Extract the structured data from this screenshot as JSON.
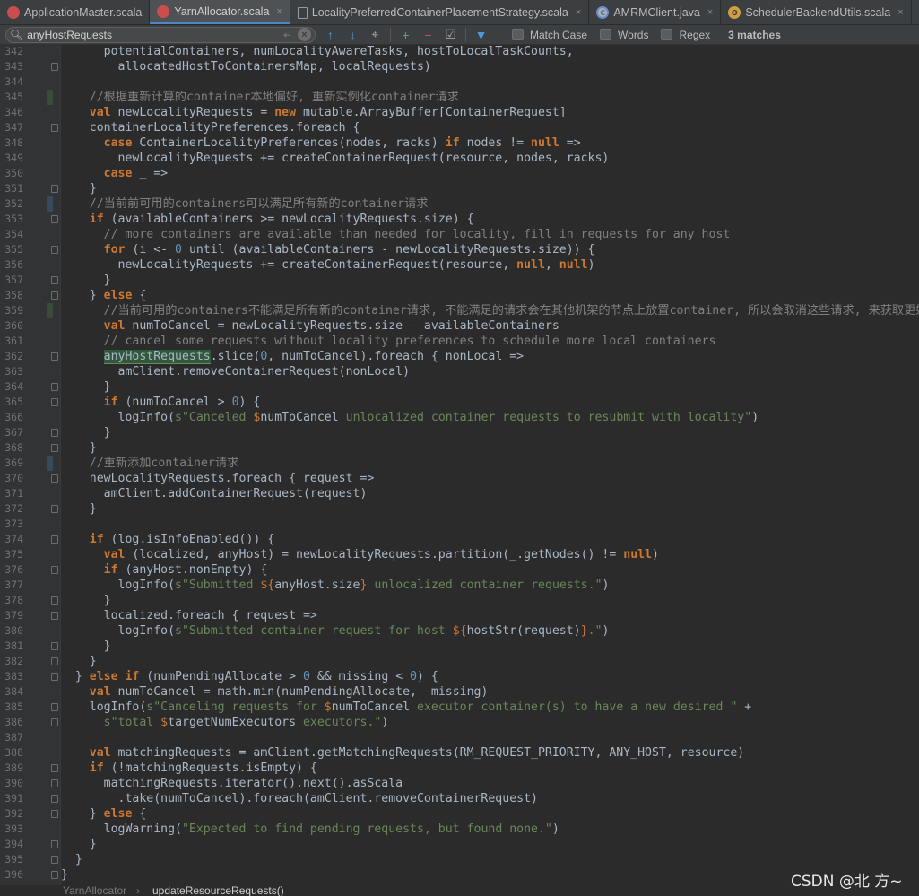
{
  "tabs": [
    {
      "label": "ApplicationMaster.scala",
      "icon": "scala-file-icon",
      "active": false,
      "closable": false
    },
    {
      "label": "YarnAllocator.scala",
      "icon": "scala-file-icon",
      "active": true,
      "closable": true
    },
    {
      "label": "LocalityPreferredContainerPlacementStrategy.scala",
      "icon": "file-icon",
      "active": false,
      "closable": true
    },
    {
      "label": "AMRMClient.java",
      "icon": "java-class-icon",
      "active": false,
      "closable": true
    },
    {
      "label": "SchedulerBackendUtils.scala",
      "icon": "scala-object-icon",
      "active": false,
      "closable": true
    },
    {
      "label": "U",
      "icon": "file-icon",
      "active": false,
      "closable": false
    }
  ],
  "findbar": {
    "query": "anyHostRequests",
    "match_case": "Match Case",
    "words": "Words",
    "regex": "Regex",
    "matches": "3 matches"
  },
  "lines": [
    {
      "n": 342,
      "marker": "",
      "fold": false,
      "indent": 0,
      "tokens": [
        [
          "      potentialContainers, numLocalityAwareTasks, hostToLocalTaskCounts,",
          ""
        ]
      ]
    },
    {
      "n": 343,
      "marker": "",
      "fold": true,
      "indent": 0,
      "tokens": [
        [
          "        allocatedHostToContainersMap, localRequests)",
          ""
        ]
      ]
    },
    {
      "n": 344,
      "marker": "",
      "fold": false,
      "indent": 0,
      "tokens": [
        [
          "",
          ""
        ]
      ]
    },
    {
      "n": 345,
      "marker": "green",
      "fold": false,
      "indent": 0,
      "tokens": [
        [
          "    //根据重新计算的container本地偏好, 重新实例化container请求",
          "cm"
        ]
      ]
    },
    {
      "n": 346,
      "marker": "",
      "fold": false,
      "indent": 0,
      "tokens": [
        [
          "    ",
          ""
        ],
        [
          "val",
          "kw"
        ],
        [
          " newLocalityRequests = ",
          ""
        ],
        [
          "new",
          "kw"
        ],
        [
          " mutable.ArrayBuffer[ContainerRequest]",
          ""
        ]
      ]
    },
    {
      "n": 347,
      "marker": "",
      "fold": true,
      "indent": 0,
      "tokens": [
        [
          "    containerLocalityPreferences.foreach {",
          ""
        ]
      ]
    },
    {
      "n": 348,
      "marker": "",
      "fold": false,
      "indent": 0,
      "tokens": [
        [
          "      ",
          ""
        ],
        [
          "case",
          "kw"
        ],
        [
          " ContainerLocalityPreferences(nodes, racks) ",
          ""
        ],
        [
          "if",
          "kw"
        ],
        [
          " nodes != ",
          ""
        ],
        [
          "null",
          "kw"
        ],
        [
          " =>",
          ""
        ]
      ]
    },
    {
      "n": 349,
      "marker": "",
      "fold": false,
      "indent": 0,
      "tokens": [
        [
          "        newLocalityRequests += createContainerRequest(resource, nodes, racks)",
          ""
        ]
      ]
    },
    {
      "n": 350,
      "marker": "",
      "fold": false,
      "indent": 0,
      "tokens": [
        [
          "      ",
          ""
        ],
        [
          "case",
          "kw"
        ],
        [
          " _ =>",
          ""
        ]
      ]
    },
    {
      "n": 351,
      "marker": "",
      "fold": true,
      "indent": 0,
      "tokens": [
        [
          "    }",
          ""
        ]
      ]
    },
    {
      "n": 352,
      "marker": "blue",
      "fold": false,
      "indent": 0,
      "tokens": [
        [
          "    //当前前可用的containers可以满足所有新的container请求",
          "cm"
        ]
      ]
    },
    {
      "n": 353,
      "marker": "",
      "fold": true,
      "indent": 0,
      "tokens": [
        [
          "    ",
          ""
        ],
        [
          "if",
          "kw"
        ],
        [
          " (availableContainers >= newLocalityRequests.size) {",
          ""
        ]
      ]
    },
    {
      "n": 354,
      "marker": "",
      "fold": false,
      "indent": 0,
      "tokens": [
        [
          "      // more containers are available than needed for locality, fill in requests for any host",
          "cm"
        ]
      ]
    },
    {
      "n": 355,
      "marker": "",
      "fold": true,
      "indent": 0,
      "tokens": [
        [
          "      ",
          ""
        ],
        [
          "for",
          "kw"
        ],
        [
          " (i <- ",
          ""
        ],
        [
          "0",
          "num"
        ],
        [
          " until (availableContainers - newLocalityRequests.size)) {",
          ""
        ]
      ]
    },
    {
      "n": 356,
      "marker": "",
      "fold": false,
      "indent": 0,
      "tokens": [
        [
          "        newLocalityRequests += createContainerRequest(resource, ",
          ""
        ],
        [
          "null",
          "kw"
        ],
        [
          ", ",
          ""
        ],
        [
          "null",
          "kw"
        ],
        [
          ")",
          ""
        ]
      ]
    },
    {
      "n": 357,
      "marker": "",
      "fold": true,
      "indent": 0,
      "tokens": [
        [
          "      }",
          ""
        ]
      ]
    },
    {
      "n": 358,
      "marker": "",
      "fold": true,
      "indent": 0,
      "tokens": [
        [
          "    } ",
          ""
        ],
        [
          "else",
          "kw"
        ],
        [
          " {",
          ""
        ]
      ]
    },
    {
      "n": 359,
      "marker": "green",
      "fold": false,
      "indent": 0,
      "tokens": [
        [
          "      //当前可用的containers不能满足所有新的container请求, 不能满足的请求会在其他机架的节点上放置container, 所以会取消这些请求, 来获取更好",
          "cm"
        ]
      ]
    },
    {
      "n": 360,
      "marker": "",
      "fold": false,
      "indent": 0,
      "tokens": [
        [
          "      ",
          ""
        ],
        [
          "val",
          "kw"
        ],
        [
          " numToCancel = newLocalityRequests.size - availableContainers",
          ""
        ]
      ]
    },
    {
      "n": 361,
      "marker": "",
      "fold": false,
      "indent": 0,
      "tokens": [
        [
          "      // cancel some requests without locality preferences to schedule more local containers",
          "cm"
        ]
      ]
    },
    {
      "n": 362,
      "marker": "",
      "fold": true,
      "indent": 0,
      "tokens": [
        [
          "      ",
          ""
        ],
        [
          "anyHostRequests",
          "hl"
        ],
        [
          ".slice(",
          ""
        ],
        [
          "0",
          "num"
        ],
        [
          ", numToCancel).foreach { nonLocal =>",
          ""
        ]
      ]
    },
    {
      "n": 363,
      "marker": "",
      "fold": false,
      "indent": 0,
      "tokens": [
        [
          "        amClient.removeContainerRequest(nonLocal)",
          ""
        ]
      ]
    },
    {
      "n": 364,
      "marker": "",
      "fold": true,
      "indent": 0,
      "tokens": [
        [
          "      }",
          ""
        ]
      ]
    },
    {
      "n": 365,
      "marker": "",
      "fold": true,
      "indent": 0,
      "tokens": [
        [
          "      ",
          ""
        ],
        [
          "if",
          "kw"
        ],
        [
          " (numToCancel > ",
          ""
        ],
        [
          "0",
          "num"
        ],
        [
          ") {",
          ""
        ]
      ]
    },
    {
      "n": 366,
      "marker": "",
      "fold": false,
      "indent": 0,
      "tokens": [
        [
          "        logInfo(",
          ""
        ],
        [
          "s\"Canceled ",
          "str"
        ],
        [
          "$",
          "interp"
        ],
        [
          "numToCancel",
          ""
        ],
        [
          " unlocalized container requests to resubmit with locality\"",
          "str"
        ],
        [
          ")",
          ""
        ]
      ]
    },
    {
      "n": 367,
      "marker": "",
      "fold": true,
      "indent": 0,
      "tokens": [
        [
          "      }",
          ""
        ]
      ]
    },
    {
      "n": 368,
      "marker": "",
      "fold": true,
      "indent": 0,
      "tokens": [
        [
          "    }",
          ""
        ]
      ]
    },
    {
      "n": 369,
      "marker": "blue",
      "fold": false,
      "indent": 0,
      "tokens": [
        [
          "    //重新添加container请求",
          "cm"
        ]
      ]
    },
    {
      "n": 370,
      "marker": "",
      "fold": true,
      "indent": 0,
      "tokens": [
        [
          "    newLocalityRequests.foreach { request =>",
          ""
        ]
      ]
    },
    {
      "n": 371,
      "marker": "",
      "fold": false,
      "indent": 0,
      "tokens": [
        [
          "      amClient.addContainerRequest(request)",
          ""
        ]
      ]
    },
    {
      "n": 372,
      "marker": "",
      "fold": true,
      "indent": 0,
      "tokens": [
        [
          "    }",
          ""
        ]
      ]
    },
    {
      "n": 373,
      "marker": "",
      "fold": false,
      "indent": 0,
      "tokens": [
        [
          "",
          ""
        ]
      ]
    },
    {
      "n": 374,
      "marker": "",
      "fold": true,
      "indent": 0,
      "tokens": [
        [
          "    ",
          ""
        ],
        [
          "if",
          "kw"
        ],
        [
          " (log.isInfoEnabled()) {",
          ""
        ]
      ]
    },
    {
      "n": 375,
      "marker": "",
      "fold": false,
      "indent": 0,
      "tokens": [
        [
          "      ",
          ""
        ],
        [
          "val",
          "kw"
        ],
        [
          " (localized, anyHost) = newLocalityRequests.partition(_.getNodes() != ",
          ""
        ],
        [
          "null",
          "kw"
        ],
        [
          ")",
          ""
        ]
      ]
    },
    {
      "n": 376,
      "marker": "",
      "fold": true,
      "indent": 0,
      "tokens": [
        [
          "      ",
          ""
        ],
        [
          "if",
          "kw"
        ],
        [
          " (anyHost.nonEmpty) {",
          ""
        ]
      ]
    },
    {
      "n": 377,
      "marker": "",
      "fold": false,
      "indent": 0,
      "tokens": [
        [
          "        logInfo(",
          ""
        ],
        [
          "s\"Submitted ",
          "str"
        ],
        [
          "${",
          "interp"
        ],
        [
          "anyHost.size",
          ""
        ],
        [
          "}",
          "interp"
        ],
        [
          " unlocalized container requests.\"",
          "str"
        ],
        [
          ")",
          ""
        ]
      ]
    },
    {
      "n": 378,
      "marker": "",
      "fold": true,
      "indent": 0,
      "tokens": [
        [
          "      }",
          ""
        ]
      ]
    },
    {
      "n": 379,
      "marker": "",
      "fold": true,
      "indent": 0,
      "tokens": [
        [
          "      localized.foreach { request =>",
          ""
        ]
      ]
    },
    {
      "n": 380,
      "marker": "",
      "fold": false,
      "indent": 0,
      "tokens": [
        [
          "        logInfo(",
          ""
        ],
        [
          "s\"Submitted container request for host ",
          "str"
        ],
        [
          "${",
          "interp"
        ],
        [
          "hostStr(request)",
          ""
        ],
        [
          "}",
          "interp"
        ],
        [
          ".\"",
          "str"
        ],
        [
          ")",
          ""
        ]
      ]
    },
    {
      "n": 381,
      "marker": "",
      "fold": true,
      "indent": 0,
      "tokens": [
        [
          "      }",
          ""
        ]
      ]
    },
    {
      "n": 382,
      "marker": "",
      "fold": true,
      "indent": 0,
      "tokens": [
        [
          "    }",
          ""
        ]
      ]
    },
    {
      "n": 383,
      "marker": "",
      "fold": true,
      "indent": 0,
      "tokens": [
        [
          "  } ",
          ""
        ],
        [
          "else if",
          "kw"
        ],
        [
          " (numPendingAllocate > ",
          ""
        ],
        [
          "0",
          "num"
        ],
        [
          " && missing < ",
          ""
        ],
        [
          "0",
          "num"
        ],
        [
          ") {",
          ""
        ]
      ]
    },
    {
      "n": 384,
      "marker": "",
      "fold": false,
      "indent": 0,
      "tokens": [
        [
          "    ",
          ""
        ],
        [
          "val",
          "kw"
        ],
        [
          " numToCancel = math.min(numPendingAllocate, -missing)",
          ""
        ]
      ]
    },
    {
      "n": 385,
      "marker": "",
      "fold": true,
      "indent": 0,
      "tokens": [
        [
          "    logInfo(",
          ""
        ],
        [
          "s\"Canceling requests for ",
          "str"
        ],
        [
          "$",
          "interp"
        ],
        [
          "numToCancel",
          ""
        ],
        [
          " executor container(s) to have a new desired \"",
          "str"
        ],
        [
          " +",
          ""
        ]
      ]
    },
    {
      "n": 386,
      "marker": "",
      "fold": true,
      "indent": 0,
      "tokens": [
        [
          "      ",
          ""
        ],
        [
          "s\"total ",
          "str"
        ],
        [
          "$",
          "interp"
        ],
        [
          "targetNumExecutors",
          ""
        ],
        [
          " executors.\"",
          "str"
        ],
        [
          ")",
          ""
        ]
      ]
    },
    {
      "n": 387,
      "marker": "",
      "fold": false,
      "indent": 0,
      "tokens": [
        [
          "",
          ""
        ]
      ]
    },
    {
      "n": 388,
      "marker": "",
      "fold": false,
      "indent": 0,
      "tokens": [
        [
          "    ",
          ""
        ],
        [
          "val",
          "kw"
        ],
        [
          " matchingRequests = amClient.getMatchingRequests(RM_REQUEST_PRIORITY, ANY_HOST, resource)",
          ""
        ]
      ]
    },
    {
      "n": 389,
      "marker": "",
      "fold": true,
      "indent": 0,
      "tokens": [
        [
          "    ",
          ""
        ],
        [
          "if",
          "kw"
        ],
        [
          " (!matchingRequests.isEmpty) {",
          ""
        ]
      ]
    },
    {
      "n": 390,
      "marker": "",
      "fold": true,
      "indent": 0,
      "tokens": [
        [
          "      matchingRequests.iterator().next().asScala",
          ""
        ]
      ]
    },
    {
      "n": 391,
      "marker": "",
      "fold": true,
      "indent": 0,
      "tokens": [
        [
          "        .take(numToCancel).foreach(amClient.removeContainerRequest)",
          ""
        ]
      ]
    },
    {
      "n": 392,
      "marker": "",
      "fold": true,
      "indent": 0,
      "tokens": [
        [
          "    } ",
          ""
        ],
        [
          "else",
          "kw"
        ],
        [
          " {",
          ""
        ]
      ]
    },
    {
      "n": 393,
      "marker": "",
      "fold": false,
      "indent": 0,
      "tokens": [
        [
          "      logWarning(",
          ""
        ],
        [
          "\"Expected to find pending requests, but found none.\"",
          "str"
        ],
        [
          ")",
          ""
        ]
      ]
    },
    {
      "n": 394,
      "marker": "",
      "fold": true,
      "indent": 0,
      "tokens": [
        [
          "    }",
          ""
        ]
      ]
    },
    {
      "n": 395,
      "marker": "",
      "fold": true,
      "indent": 0,
      "tokens": [
        [
          "  }",
          ""
        ]
      ]
    },
    {
      "n": 396,
      "marker": "",
      "fold": true,
      "indent": 0,
      "tokens": [
        [
          "}",
          ""
        ]
      ]
    }
  ],
  "breadcrumb": {
    "items": [
      "YarnAllocator",
      "updateResourceRequests()"
    ],
    "separator": "›"
  },
  "watermark": "CSDN @北 方~"
}
